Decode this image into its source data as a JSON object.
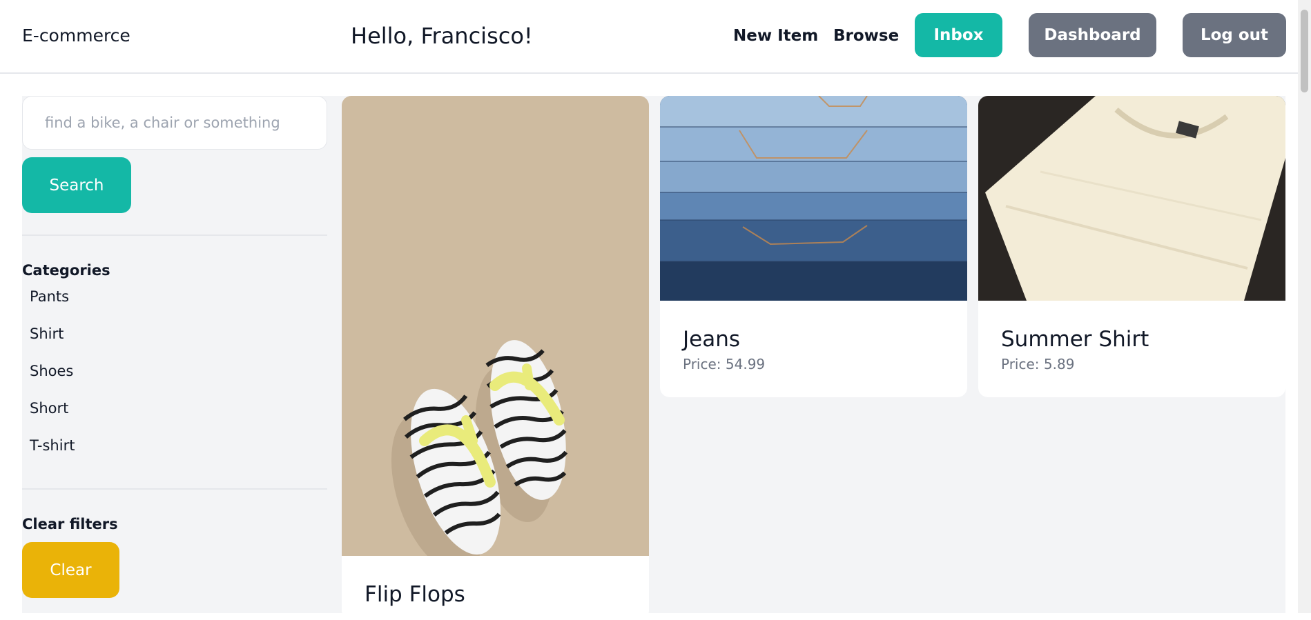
{
  "header": {
    "brand": "E-commerce",
    "greeting": "Hello, Francisco!",
    "links": {
      "new_item": "New Item",
      "browse": "Browse"
    },
    "buttons": {
      "inbox": "Inbox",
      "dashboard": "Dashboard",
      "logout": "Log out"
    }
  },
  "sidebar": {
    "search": {
      "placeholder": "find a bike, a chair or something",
      "value": "",
      "button_label": "Search"
    },
    "categories": {
      "title": "Categories",
      "items": [
        "Pants",
        "Shirt",
        "Shoes",
        "Short",
        "T-shirt"
      ]
    },
    "clear": {
      "title": "Clear filters",
      "button_label": "Clear"
    }
  },
  "products": [
    {
      "name": "Flip Flops",
      "image": "flip-flops-photo"
    },
    {
      "name": "Jeans",
      "price": "Price: 54.99",
      "image": "jeans-photo"
    },
    {
      "name": "Summer Shirt",
      "price": "Price: 5.89",
      "image": "shirt-photo"
    }
  ],
  "colors": {
    "primary": "#14b8a6",
    "secondary": "#6b7280",
    "warning": "#eab308",
    "background": "#f3f4f6"
  }
}
